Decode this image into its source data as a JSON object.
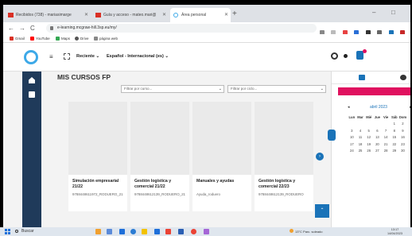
{
  "browser": {
    "tabs": [
      {
        "label": "Recibidos (738) - mariasimarge",
        "active": false
      },
      {
        "label": "Guía y acceso - mateo.mari@",
        "active": false
      },
      {
        "label": "Área personal",
        "active": true
      }
    ],
    "new_tab": "+",
    "window": {
      "minimize": "–",
      "maximize": "□"
    },
    "nav": {
      "back": "←",
      "forward": "→",
      "reload": "C"
    },
    "url": "e-learning.mcgraw-hill.3sp.eu/my/",
    "bookmarks": [
      {
        "label": "Gmail",
        "color": "#d93025"
      },
      {
        "label": "YouTube",
        "color": "#ff0000"
      },
      {
        "label": "Maps",
        "color": "#34a853"
      },
      {
        "label": "Drive",
        "color": "#555"
      },
      {
        "label": "página web",
        "color": "#888"
      }
    ]
  },
  "app": {
    "hamburger": "≡",
    "recent_label": "Reciente ⌄",
    "language_label": "Español - Internacional (es) ⌄"
  },
  "main": {
    "title": "MIS CURSOS FP",
    "filters": {
      "course_placeholder": "Filtrar por curso...",
      "cycle_placeholder": "Filtrar por ciclo..."
    },
    "courses": [
      {
        "title": "Simulación empresarial 21/22",
        "subtitle": "9788448611972_RODUERO_21"
      },
      {
        "title": "Gestión logística y comercial 21/22",
        "subtitle": "9788448612139_RODUERO_21"
      },
      {
        "title": "Manuales y ayudas",
        "subtitle": "Ayuda_roduero"
      },
      {
        "title": "Gestión logística y comercial 22/23",
        "subtitle": "9788448612139_RODUERO"
      }
    ],
    "next_glyph": "›",
    "scroll_top_glyph": "⌃"
  },
  "calendar": {
    "month": "abril 2023",
    "prev": "◂",
    "next": "▸",
    "weekdays": [
      "Lun",
      "Mar",
      "Mié",
      "Jue",
      "Vie",
      "Sáb",
      "Dom"
    ],
    "weeks": [
      [
        "",
        "",
        "",
        "",
        "",
        "1",
        "2"
      ],
      [
        "3",
        "4",
        "5",
        "6",
        "7",
        "8",
        "9"
      ],
      [
        "10",
        "11",
        "12",
        "13",
        "14",
        "15",
        "16"
      ],
      [
        "17",
        "18",
        "19",
        "20",
        "21",
        "22",
        "23"
      ],
      [
        "24",
        "25",
        "26",
        "27",
        "28",
        "29",
        "30"
      ]
    ],
    "header_color": "#e0115f"
  },
  "taskbar": {
    "search_label": "Buscar",
    "weather": "13°C Parc. soleado",
    "time": "13:17",
    "date": "14/04/2023"
  },
  "colors": {
    "accent": "#1a73b8",
    "rail": "#1f3a5a",
    "logo": "#3da9e8"
  }
}
